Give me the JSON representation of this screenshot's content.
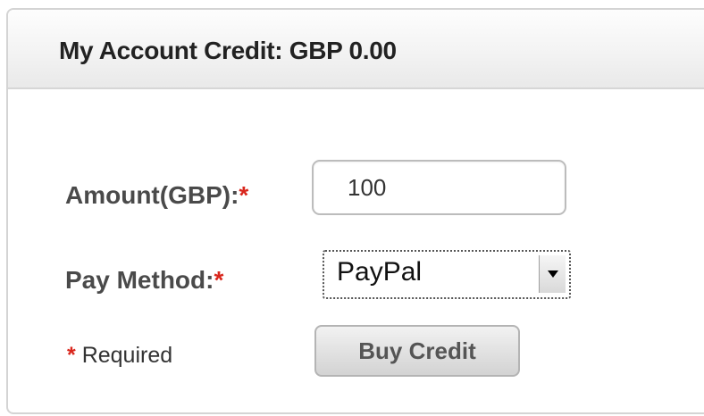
{
  "header": {
    "title": "My Account Credit: GBP 0.00"
  },
  "form": {
    "amount_label": "Amount(GBP):",
    "amount_value": "100",
    "required_star": "*",
    "pay_method_label": "Pay Method:",
    "pay_method_selected": "PayPal",
    "required_note": "Required",
    "buy_button_label": "Buy Credit"
  },
  "icons": {
    "select_arrow": "chevron-down-icon"
  },
  "colors": {
    "required_star": "#d9261c",
    "header_background": "#f3f3f3",
    "button_background": "#e2e2e2"
  }
}
